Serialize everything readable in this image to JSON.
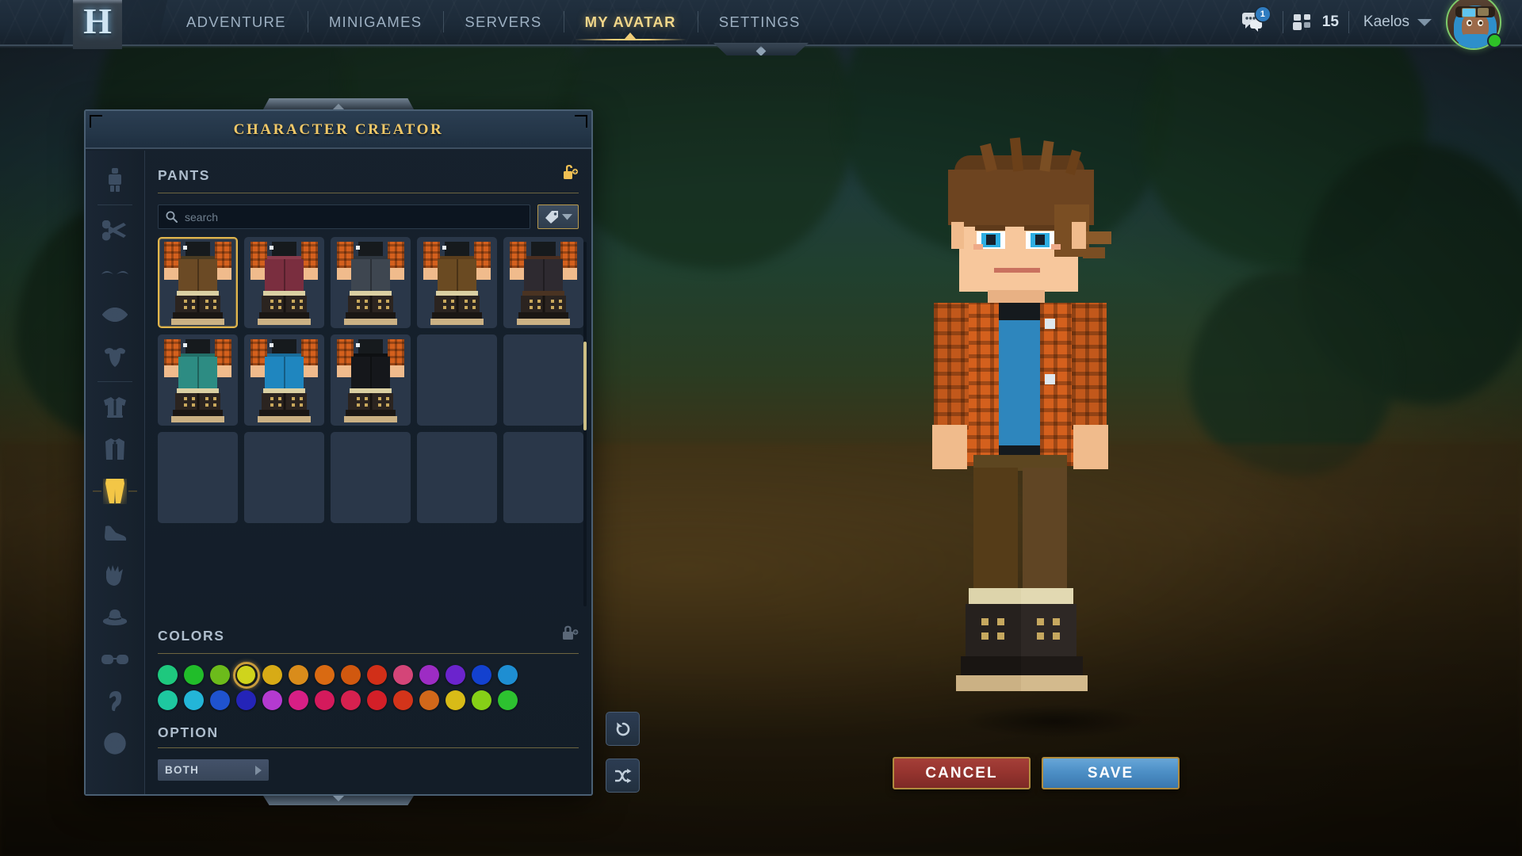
{
  "topbar": {
    "logo_letter": "H",
    "nav": [
      {
        "id": "adventure",
        "label": "ADVENTURE",
        "active": false
      },
      {
        "id": "minigames",
        "label": "MINIGAMES",
        "active": false
      },
      {
        "id": "servers",
        "label": "SERVERS",
        "active": false
      },
      {
        "id": "my-avatar",
        "label": "MY AVATAR",
        "active": true
      },
      {
        "id": "settings",
        "label": "SETTINGS",
        "active": false
      }
    ],
    "chat_badge": "1",
    "friends_count": "15",
    "username": "Kaelos",
    "status": "online",
    "status_color": "#2ec027"
  },
  "panel": {
    "title": "CHARACTER CREATOR",
    "sidebar": [
      {
        "id": "body",
        "icon": "body-icon",
        "active": false
      },
      {
        "id": "hair",
        "icon": "scissors-icon",
        "active": false
      },
      {
        "id": "eyebrows",
        "icon": "eyebrows-icon",
        "active": false
      },
      {
        "id": "eyes",
        "icon": "eye-icon",
        "active": false
      },
      {
        "id": "beard",
        "icon": "beard-icon",
        "active": false
      },
      {
        "id": "shirt",
        "icon": "shirt-icon",
        "active": false
      },
      {
        "id": "coat",
        "icon": "coat-icon",
        "active": false
      },
      {
        "id": "pants",
        "icon": "pants-icon",
        "active": true
      },
      {
        "id": "shoes",
        "icon": "boot-icon",
        "active": false
      },
      {
        "id": "gloves",
        "icon": "hand-icon",
        "active": false
      },
      {
        "id": "hat",
        "icon": "hat-icon",
        "active": false
      },
      {
        "id": "glasses",
        "icon": "glasses-icon",
        "active": false
      },
      {
        "id": "earrings",
        "icon": "ear-icon",
        "active": false
      },
      {
        "id": "emote",
        "icon": "smiley-icon",
        "active": false
      }
    ],
    "items_section": {
      "title": "PANTS",
      "lock_state": "unlocked",
      "lock_icon": "lock-open-icon",
      "search": {
        "value": "",
        "placeholder": "search",
        "icon": "search-icon"
      },
      "filter_button": {
        "icon": "tag-icon",
        "caret": "chevron-down-icon"
      },
      "items": [
        {
          "id": "pants-1",
          "name": "brown-trousers",
          "selected": true,
          "empty": false,
          "pants_color": "#6b4a25",
          "belt_color": "#4a3b22",
          "cuff_color": "#dbd0a3",
          "pip": true
        },
        {
          "id": "pants-2",
          "name": "maroon-shorts",
          "selected": false,
          "empty": false,
          "pants_color": "#7a2e3f",
          "belt_color": "#8a3b4c",
          "cuff_color": "#dbd0a3",
          "pip": true
        },
        {
          "id": "pants-3",
          "name": "grey-ripped-jeans",
          "selected": false,
          "empty": false,
          "pants_color": "#3e4650",
          "belt_color": "#2e363f",
          "cuff_color": "#dbd0a3",
          "pip": true
        },
        {
          "id": "pants-4",
          "name": "brown-worn-pants",
          "selected": false,
          "empty": false,
          "pants_color": "#6a4a22",
          "belt_color": "#5b3e1c",
          "cuff_color": "#dbd0a3",
          "pip": true
        },
        {
          "id": "pants-5",
          "name": "dark-leather-armor",
          "selected": false,
          "empty": false,
          "pants_color": "#2e2a30",
          "belt_color": "#4a2e20",
          "cuff_color": "#4a3322",
          "pip": false
        },
        {
          "id": "pants-6",
          "name": "teal-shorts",
          "selected": false,
          "empty": false,
          "pants_color": "#2d8c83",
          "belt_color": "#236f68",
          "cuff_color": "#dbd0a3",
          "pip": true
        },
        {
          "id": "pants-7",
          "name": "blue-shorts",
          "selected": false,
          "empty": false,
          "pants_color": "#1f86bf",
          "belt_color": "#1a6d9b",
          "cuff_color": "#dbd0a3",
          "pip": true
        },
        {
          "id": "pants-8",
          "name": "black-trousers",
          "selected": false,
          "empty": false,
          "pants_color": "#15171b",
          "belt_color": "#0e1012",
          "cuff_color": "#dbd0a3",
          "pip": true
        },
        {
          "id": "slot-9",
          "name": "empty-slot",
          "selected": false,
          "empty": true
        },
        {
          "id": "slot-10",
          "name": "empty-slot",
          "selected": false,
          "empty": true
        },
        {
          "id": "slot-11",
          "name": "empty-slot",
          "selected": false,
          "empty": true
        },
        {
          "id": "slot-12",
          "name": "empty-slot",
          "selected": false,
          "empty": true
        },
        {
          "id": "slot-13",
          "name": "empty-slot",
          "selected": false,
          "empty": true
        },
        {
          "id": "slot-14",
          "name": "empty-slot",
          "selected": false,
          "empty": true
        },
        {
          "id": "slot-15",
          "name": "empty-slot",
          "selected": false,
          "empty": true
        }
      ]
    },
    "colors_section": {
      "title": "COLORS",
      "lock_state": "locked",
      "lock_icon": "lock-closed-icon",
      "rows": [
        [
          "#1ec87e",
          "#21bd2a",
          "#6cbb1b",
          "#cfd41c",
          "#d7ab16",
          "#d98c1b",
          "#d96a12",
          "#d1580f",
          "#d12f18",
          "#d44578",
          "#9d2cc4",
          "#6b24cd",
          "#1341cf",
          "#1e8ed2"
        ],
        [
          "#1ec8a0",
          "#23b5d8",
          "#1f53cf",
          "#2424b8",
          "#b43ad0",
          "#d71f85",
          "#d41a5c",
          "#d6214f",
          "#d31f28",
          "#d3341a",
          "#d1681a",
          "#d8bb17",
          "#86d017",
          "#2dc230"
        ]
      ],
      "selected": {
        "row": 0,
        "index": 3
      }
    },
    "option_section": {
      "title": "OPTION",
      "value": "BOTH",
      "caret": "chevron-right-icon"
    }
  },
  "actions": {
    "reset": {
      "label": "",
      "icon": "undo-icon"
    },
    "randomize": {
      "label": "",
      "icon": "shuffle-icon"
    },
    "cancel": {
      "label": "CANCEL"
    },
    "save": {
      "label": "SAVE"
    }
  },
  "theme": {
    "gold": "#f0c868",
    "panel_bg": "#16212d",
    "accent_blue": "#4d8fc6",
    "accent_red": "#96342f"
  }
}
